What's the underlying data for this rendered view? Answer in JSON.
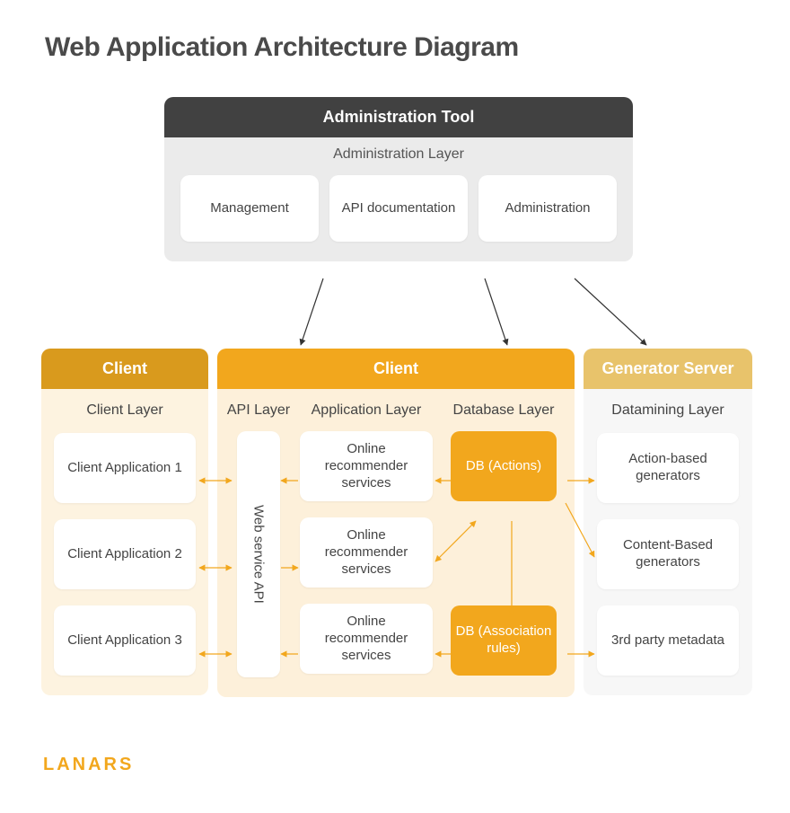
{
  "title": "Web Application Architecture Diagram",
  "admin": {
    "header": "Administration Tool",
    "layer": "Administration Layer",
    "cards": [
      "Management",
      "API documentation",
      "Administration"
    ]
  },
  "client_left": {
    "header": "Client",
    "layer": "Client Layer",
    "cards": [
      "Client Application 1",
      "Client Application 2",
      "Client Application 3"
    ]
  },
  "main": {
    "header": "Client",
    "api_layer": "API Layer",
    "app_layer": "Application Layer",
    "db_layer": "Database Layer",
    "api_card": "Web service API",
    "app_cards": [
      "Online recommender services",
      "Online recommender services",
      "Online recommender services"
    ],
    "db_cards": [
      "DB (Actions)",
      "DB (Association rules)"
    ]
  },
  "generator": {
    "header": "Generator Server",
    "layer": "Datamining Layer",
    "cards": [
      "Action-based generators",
      "Content-Based generators",
      "3rd party metadata"
    ]
  },
  "logo": "LANARS"
}
